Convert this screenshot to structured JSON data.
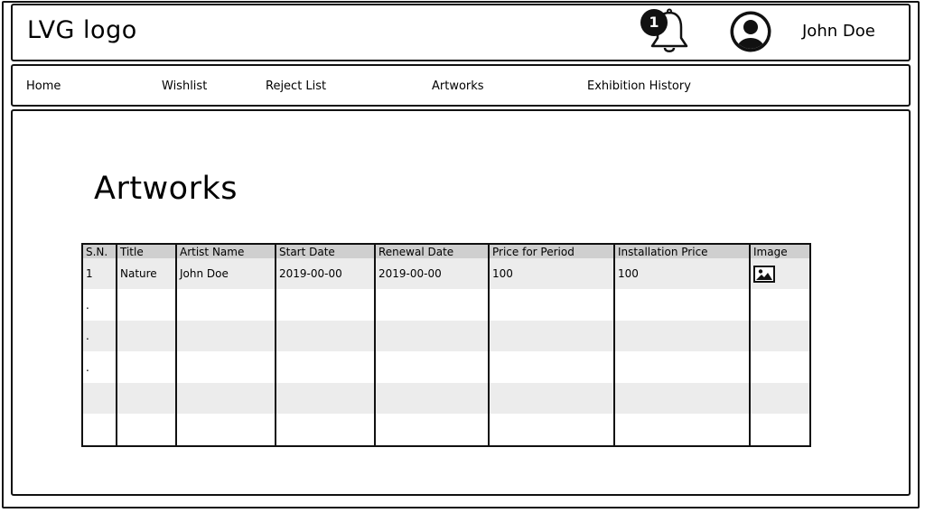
{
  "header": {
    "logo_text": "LVG logo",
    "notification_count": "1",
    "user_name": "John Doe"
  },
  "nav": {
    "items": [
      {
        "label": "Home"
      },
      {
        "label": "Wishlist"
      },
      {
        "label": "Reject List"
      },
      {
        "label": "Artworks"
      },
      {
        "label": "Exhibition History"
      }
    ]
  },
  "main": {
    "title": "Artworks",
    "table": {
      "columns": [
        "S.N.",
        "Title",
        "Artist Name",
        "Start Date",
        "Renewal Date",
        "Price for Period",
        "Installation Price",
        "Image"
      ],
      "rows": [
        [
          "1",
          "Nature",
          "John Doe",
          "2019-00-00",
          "2019-00-00",
          "100",
          "100",
          ""
        ],
        [
          ".",
          "",
          "",
          "",
          "",
          "",
          "",
          ""
        ],
        [
          ".",
          "",
          "",
          "",
          "",
          "",
          "",
          ""
        ],
        [
          ".",
          "",
          "",
          "",
          "",
          "",
          "",
          ""
        ],
        [
          "",
          "",
          "",
          "",
          "",
          "",
          "",
          ""
        ],
        [
          "",
          "",
          "",
          "",
          "",
          "",
          "",
          ""
        ]
      ],
      "image_cell_icon": "image-icon"
    }
  },
  "icons": {
    "notification": "bell-icon",
    "user": "user-avatar-icon",
    "artwork_image": "image-icon"
  }
}
